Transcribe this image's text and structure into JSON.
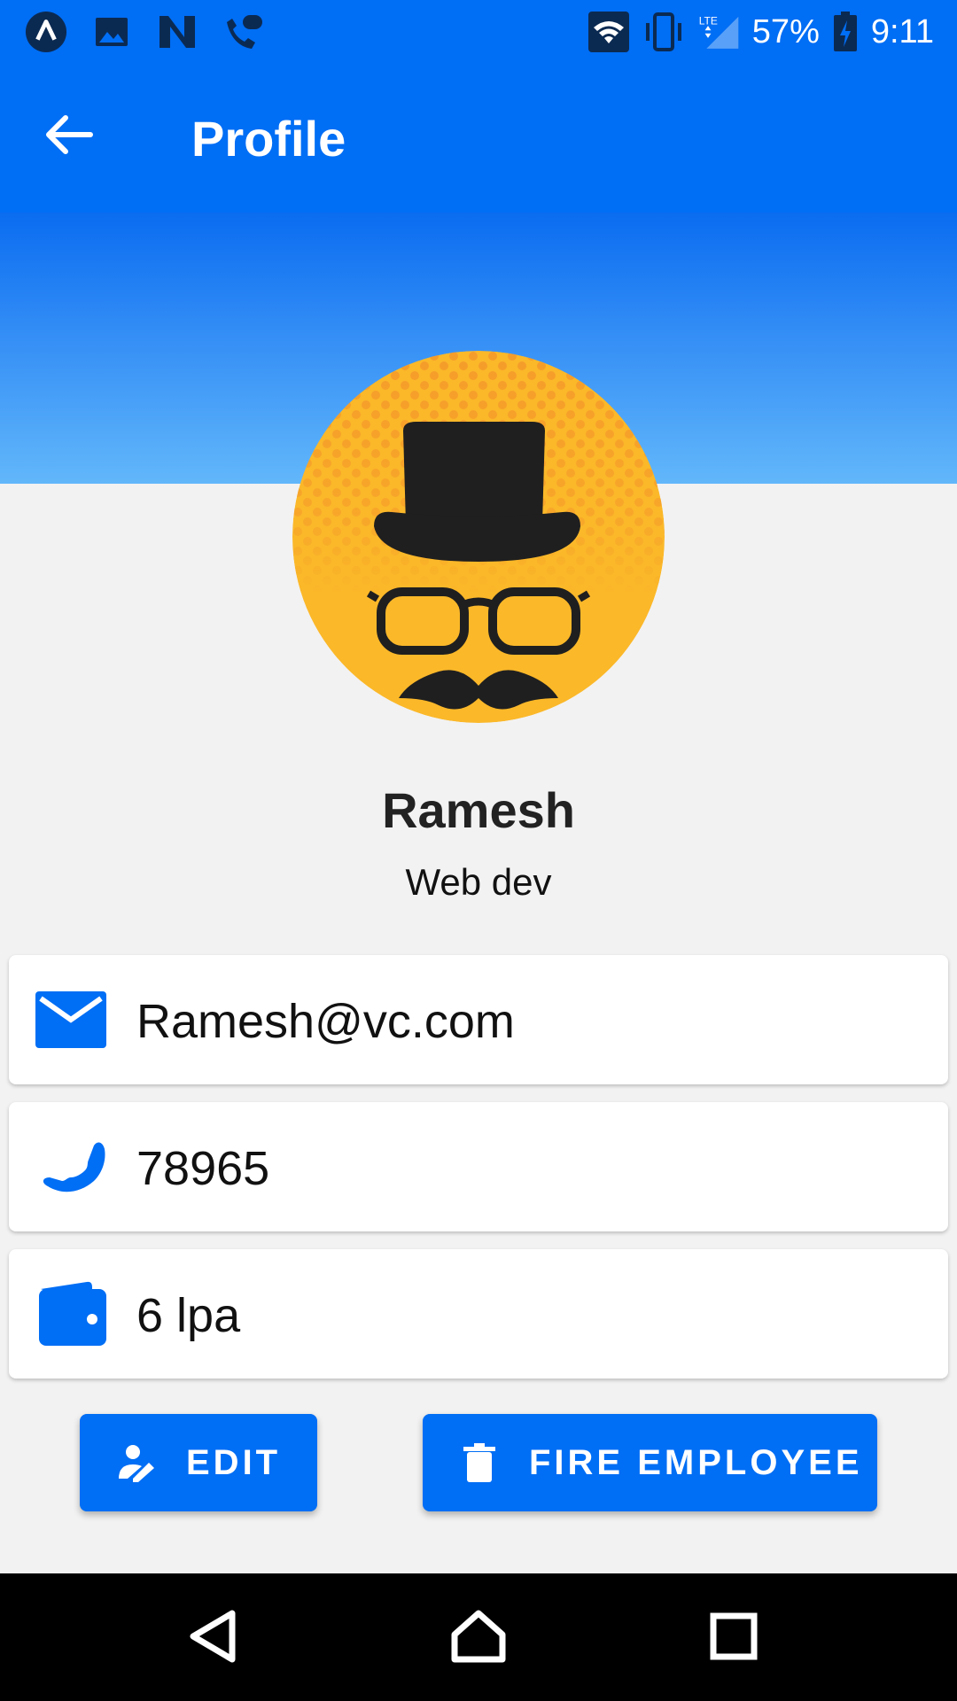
{
  "status_bar": {
    "battery": "57%",
    "time": "9:11",
    "network": "LTE",
    "icons_left": [
      "app-a-icon",
      "image-icon",
      "n-icon",
      "voicemail-icon"
    ],
    "icons_right": [
      "wifi-icon",
      "vibrate-icon",
      "signal-icon",
      "battery-icon"
    ]
  },
  "appbar": {
    "title": "Profile",
    "back_icon": "arrow-left-icon"
  },
  "profile": {
    "name": "Ramesh",
    "role": "Web dev",
    "avatar": "gentleman-avatar"
  },
  "details": [
    {
      "icon": "mail-icon",
      "text": "Ramesh@vc.com"
    },
    {
      "icon": "phone-icon",
      "text": "78965"
    },
    {
      "icon": "wallet-icon",
      "text": "6 lpa"
    }
  ],
  "actions": {
    "edit_label": "EDIT",
    "fire_label": "FIRE EMPLOYEE"
  },
  "colors": {
    "primary": "#006ef5",
    "background": "#f2f2f2",
    "avatar_bg": "#fbb829"
  }
}
